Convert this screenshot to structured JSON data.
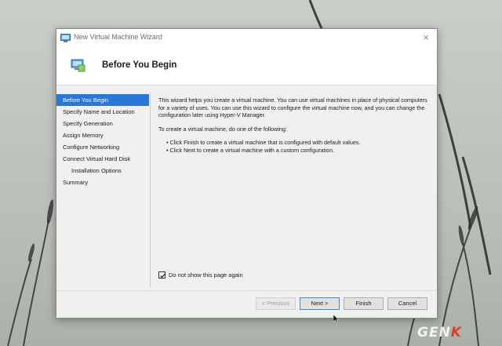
{
  "window": {
    "title": "New Virtual Machine Wizard",
    "close_glyph": "×"
  },
  "header": {
    "title": "Before You Begin",
    "icon": "virtual-machine-icon"
  },
  "nav": {
    "items": [
      {
        "label": "Before You Begin",
        "active": true
      },
      {
        "label": "Specify Name and Location"
      },
      {
        "label": "Specify Generation"
      },
      {
        "label": "Assign Memory"
      },
      {
        "label": "Configure Networking"
      },
      {
        "label": "Connect Virtual Hard Disk"
      },
      {
        "label": "Installation Options",
        "sub": true
      },
      {
        "label": "Summary"
      }
    ]
  },
  "content": {
    "intro": "This wizard helps you create a virtual machine. You can use virtual machines in place of physical computers for a variety of uses. You can use this wizard to configure the virtual machine now, and you can change the configuration later using Hyper-V Manager.",
    "prompt": "To create a virtual machine, do one of the following:",
    "bullets": [
      "• Click Finish to create a virtual machine that is configured with default values.",
      "• Click Next to create a virtual machine with a custom configuration."
    ]
  },
  "checkbox": {
    "label": "Do not show this page again",
    "checked": true
  },
  "buttons": {
    "previous": "< Previous",
    "next": "Next >",
    "finish": "Finish",
    "cancel": "Cancel"
  },
  "watermark": {
    "text_main": "GEN",
    "text_accent": "K"
  },
  "colors": {
    "accent": "#2a78d5",
    "watermark_accent": "#e53b2c"
  }
}
